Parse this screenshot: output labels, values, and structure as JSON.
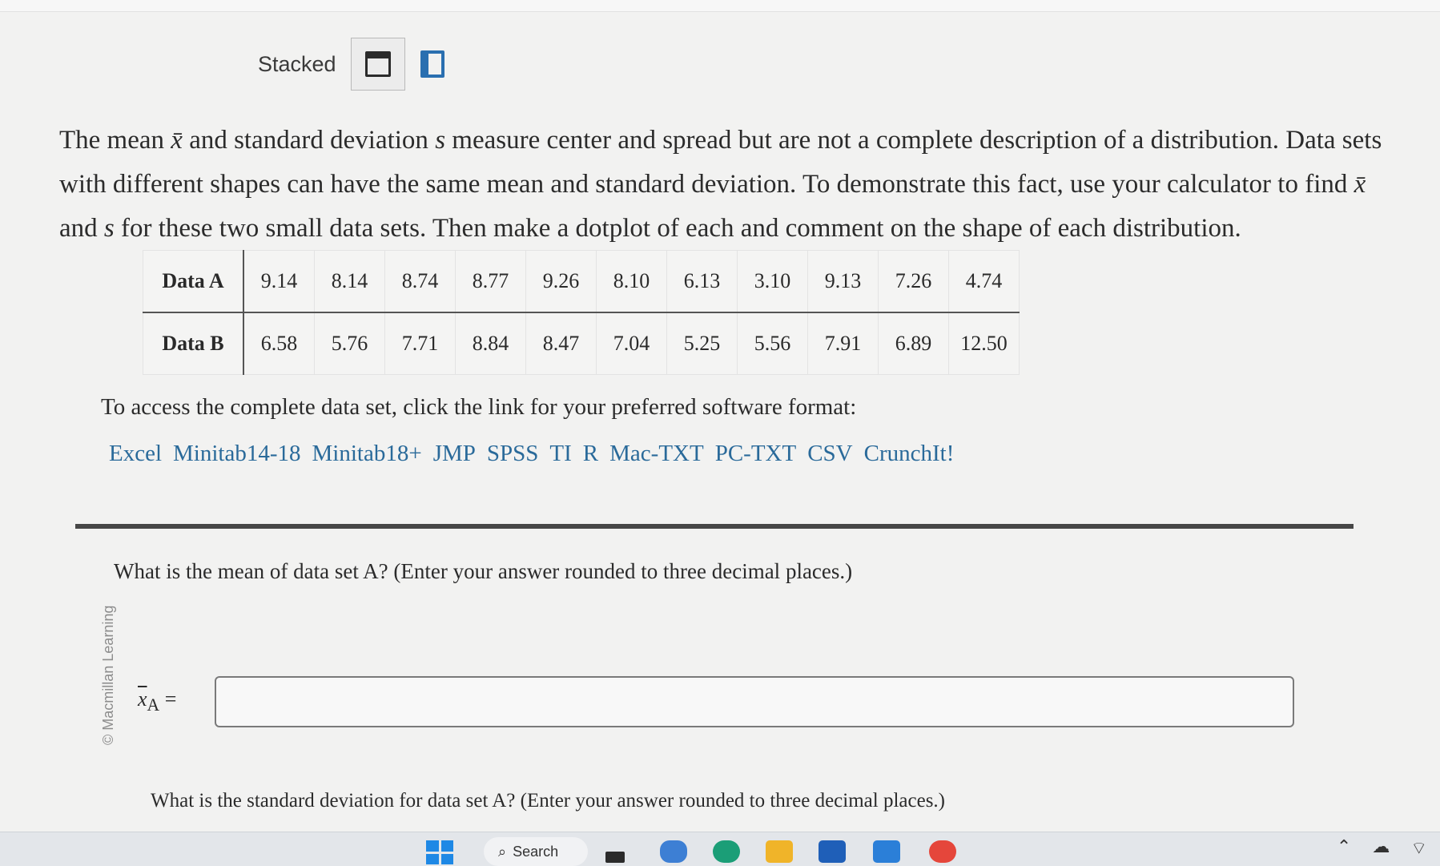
{
  "view": {
    "label": "Stacked"
  },
  "question": {
    "part1": "The mean ",
    "xbar": "x̄",
    "part2": " and standard deviation ",
    "s": "s",
    "part3": " measure center and spread but are not a complete description of a distribution. Data sets with different shapes can have the same mean and standard deviation. To demonstrate this fact, use your calculator to find ",
    "xbar2": "x̄",
    "part4": " and ",
    "s2": "s",
    "part5": " for these two small data sets. Then make a dotplot of each and comment on the shape of each distribution."
  },
  "table": {
    "rows": [
      {
        "label": "Data A",
        "values": [
          "9.14",
          "8.14",
          "8.74",
          "8.77",
          "9.26",
          "8.10",
          "6.13",
          "3.10",
          "9.13",
          "7.26",
          "4.74"
        ]
      },
      {
        "label": "Data B",
        "values": [
          "6.58",
          "5.76",
          "7.71",
          "8.84",
          "8.47",
          "7.04",
          "5.25",
          "5.56",
          "7.91",
          "6.89",
          "12.50"
        ]
      }
    ]
  },
  "access_text": "To access the complete data set, click the link for your preferred software format:",
  "links": [
    "Excel",
    "Minitab14-18",
    "Minitab18+",
    "JMP",
    "SPSS",
    "TI",
    "R",
    "Mac-TXT",
    "PC-TXT",
    "CSV",
    "CrunchIt!"
  ],
  "watermark": "© Macmillan Learning",
  "q1": {
    "text": "What is the mean of data set A? (Enter your answer rounded to three decimal places.)",
    "label_x": "x",
    "label_sub": "A",
    "label_eq": " =",
    "input_value": ""
  },
  "q2": {
    "text": "What is the standard deviation for data set A? (Enter your answer rounded to three decimal places.)"
  },
  "taskbar": {
    "search_label": "Search",
    "icons": [
      "windows-start-icon",
      "search-icon",
      "task-view-icon",
      "meet-icon",
      "edge-browser-icon",
      "file-explorer-icon",
      "store-icon",
      "mail-icon",
      "chrome-icon"
    ]
  }
}
